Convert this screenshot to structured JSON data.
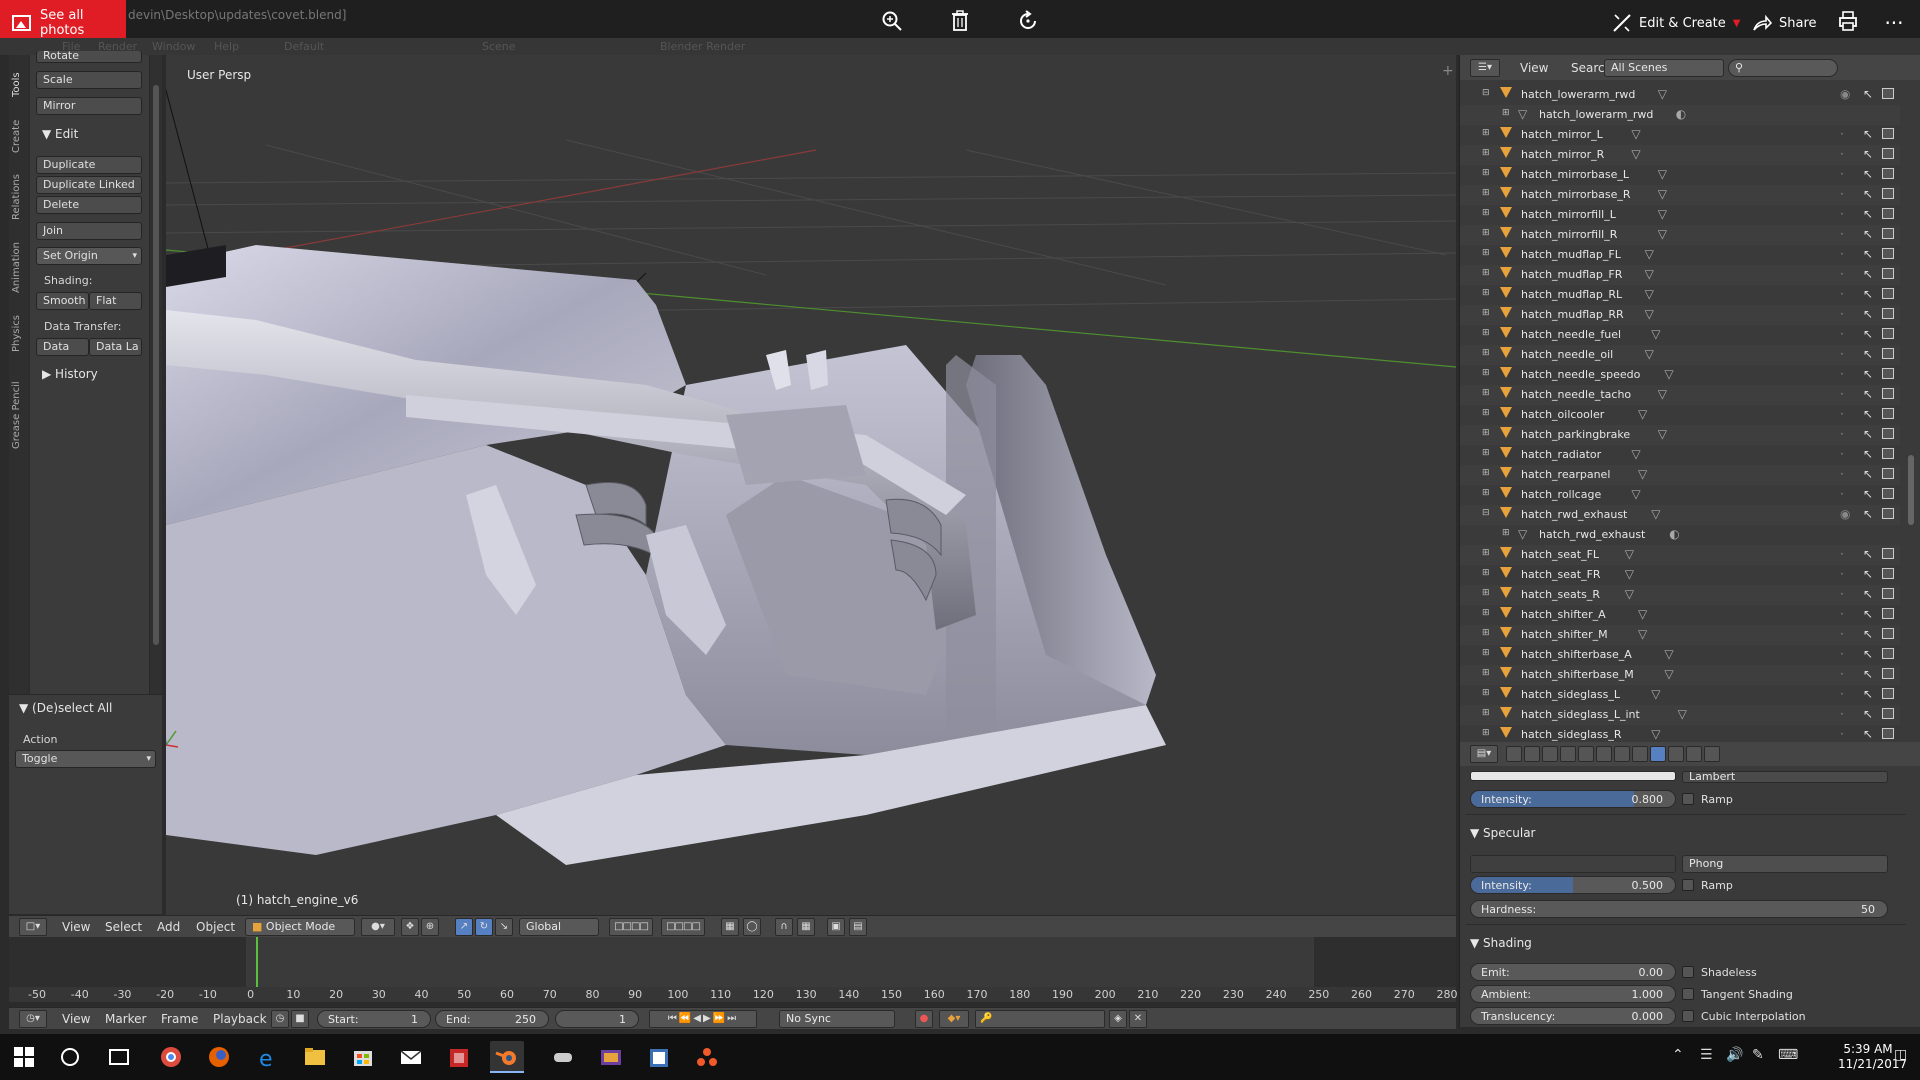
{
  "photos_bar": {
    "see_all": "See all photos",
    "file_path": "devin\\Desktop\\updates\\covet.blend]",
    "edit_create": "Edit & Create",
    "share": "Share"
  },
  "blender_header": {
    "menus": [
      "File",
      "Render",
      "Window",
      "Help"
    ],
    "layout": "Default",
    "scene": "Scene",
    "engine": "Blender Render"
  },
  "tool_tabs": [
    "Tools",
    "Create",
    "Relations",
    "Animation",
    "Physics",
    "Grease Pencil"
  ],
  "tool_shelf": {
    "rotate": "Rotate",
    "scale": "Scale",
    "mirror": "Mirror",
    "edit_header": "Edit",
    "duplicate": "Duplicate",
    "duplicate_linked": "Duplicate Linked",
    "delete": "Delete",
    "join": "Join",
    "set_origin": "Set Origin",
    "shading_label": "Shading:",
    "smooth": "Smooth",
    "flat": "Flat",
    "data_transfer_label": "Data Transfer:",
    "data": "Data",
    "data_layout": "Data La",
    "history_header": "History"
  },
  "operator_panel": {
    "title": "(De)select All",
    "action_label": "Action",
    "action_value": "Toggle"
  },
  "viewport": {
    "view_name": "User Persp",
    "active_object": "(1) hatch_engine_v6"
  },
  "view3d_header": {
    "menus": [
      "View",
      "Select",
      "Add",
      "Object"
    ],
    "mode": "Object Mode",
    "orientation": "Global"
  },
  "timeline": {
    "ticks": [
      "-50",
      "-40",
      "-30",
      "-20",
      "-10",
      "0",
      "10",
      "20",
      "30",
      "40",
      "50",
      "60",
      "70",
      "80",
      "90",
      "100",
      "110",
      "120",
      "130",
      "140",
      "150",
      "160",
      "170",
      "180",
      "190",
      "200",
      "210",
      "220",
      "230",
      "240",
      "250",
      "260",
      "270",
      "280"
    ],
    "menus": [
      "View",
      "Marker",
      "Frame",
      "Playback"
    ],
    "start_label": "Start:",
    "start_value": "1",
    "end_label": "End:",
    "end_value": "250",
    "current_frame": "1",
    "sync": "No Sync"
  },
  "outliner": {
    "header_view": "View",
    "header_search": "Search",
    "scene_filter": "All Scenes",
    "rows": [
      {
        "name": "hatch_lowerarm_rwd",
        "level": 0,
        "expanded": true,
        "eye": true
      },
      {
        "name": "hatch_lowerarm_rwd",
        "level": 1,
        "mesh": true
      },
      {
        "name": "hatch_mirror_L",
        "level": 0
      },
      {
        "name": "hatch_mirror_R",
        "level": 0
      },
      {
        "name": "hatch_mirrorbase_L",
        "level": 0
      },
      {
        "name": "hatch_mirrorbase_R",
        "level": 0
      },
      {
        "name": "hatch_mirrorfill_L",
        "level": 0
      },
      {
        "name": "hatch_mirrorfill_R",
        "level": 0
      },
      {
        "name": "hatch_mudflap_FL",
        "level": 0
      },
      {
        "name": "hatch_mudflap_FR",
        "level": 0
      },
      {
        "name": "hatch_mudflap_RL",
        "level": 0
      },
      {
        "name": "hatch_mudflap_RR",
        "level": 0
      },
      {
        "name": "hatch_needle_fuel",
        "level": 0
      },
      {
        "name": "hatch_needle_oil",
        "level": 0
      },
      {
        "name": "hatch_needle_speedo",
        "level": 0
      },
      {
        "name": "hatch_needle_tacho",
        "level": 0
      },
      {
        "name": "hatch_oilcooler",
        "level": 0
      },
      {
        "name": "hatch_parkingbrake",
        "level": 0
      },
      {
        "name": "hatch_radiator",
        "level": 0
      },
      {
        "name": "hatch_rearpanel",
        "level": 0
      },
      {
        "name": "hatch_rollcage",
        "level": 0
      },
      {
        "name": "hatch_rwd_exhaust",
        "level": 0,
        "expanded": true,
        "eye": true
      },
      {
        "name": "hatch_rwd_exhaust",
        "level": 1,
        "mesh": true
      },
      {
        "name": "hatch_seat_FL",
        "level": 0
      },
      {
        "name": "hatch_seat_FR",
        "level": 0
      },
      {
        "name": "hatch_seats_R",
        "level": 0
      },
      {
        "name": "hatch_shifter_A",
        "level": 0
      },
      {
        "name": "hatch_shifter_M",
        "level": 0
      },
      {
        "name": "hatch_shifterbase_A",
        "level": 0
      },
      {
        "name": "hatch_shifterbase_M",
        "level": 0
      },
      {
        "name": "hatch_sideglass_L",
        "level": 0
      },
      {
        "name": "hatch_sideglass_L_int",
        "level": 0
      },
      {
        "name": "hatch_sideglass_R",
        "level": 0
      }
    ]
  },
  "properties": {
    "diffuse_shader": "Lambert",
    "diffuse_intensity_label": "Intensity:",
    "diffuse_intensity": "0.800",
    "diffuse_intensity_fraction": 0.8,
    "ramp_label": "Ramp",
    "specular_header": "Specular",
    "specular_shader": "Phong",
    "specular_intensity_label": "Intensity:",
    "specular_intensity": "0.500",
    "specular_intensity_fraction": 0.5,
    "hardness_label": "Hardness:",
    "hardness_value": "50",
    "shading_header": "Shading",
    "emit_label": "Emit:",
    "emit_value": "0.00",
    "ambient_label": "Ambient:",
    "ambient_value": "1.000",
    "translucency_label": "Translucency:",
    "translucency_value": "0.000",
    "shadeless": "Shadeless",
    "tangent_shading": "Tangent Shading",
    "cubic_interpolation": "Cubic Interpolation"
  },
  "taskbar": {
    "time": "5:39 AM",
    "date": "11/21/2017"
  },
  "colors": {
    "photos_accent": "#e01d24",
    "blender_panel": "#3b3b3b",
    "object_orange": "#e8a23c",
    "selection_blue": "#5680c2",
    "frame_green": "#5ac13e"
  }
}
